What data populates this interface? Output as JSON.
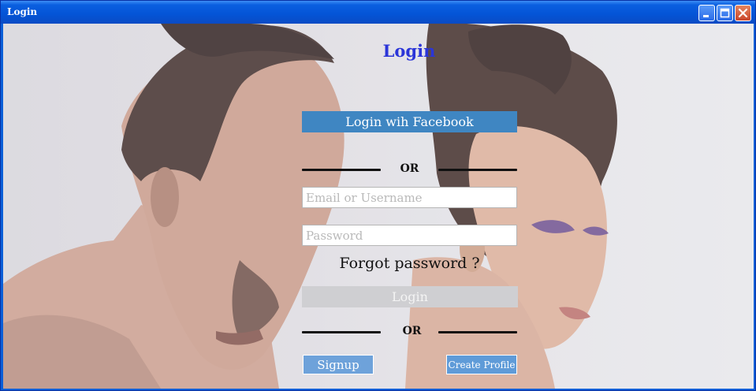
{
  "window": {
    "title": "Login",
    "controls": {
      "minimize_icon": "minimize-icon",
      "maximize_icon": "maximize-icon",
      "close_icon": "close-icon"
    }
  },
  "form": {
    "heading": "Login",
    "facebook_button": "Login wih Facebook",
    "or_top": "OR",
    "email_placeholder": "Email or Username",
    "email_value": "",
    "password_placeholder": "Password",
    "password_value": "",
    "forgot_link": "Forgot password ?",
    "login_button": "Login",
    "or_bottom": "OR",
    "signup_button": "Signup",
    "create_profile_button": "Create Profile"
  },
  "colors": {
    "heading": "#2b35d8",
    "facebook_button": "#3f86c2",
    "login_button": "#cfcfd2",
    "signup_button": "#6ea2da",
    "create_profile_button": "#5f9bd8",
    "titlebar": "#0454d6"
  }
}
